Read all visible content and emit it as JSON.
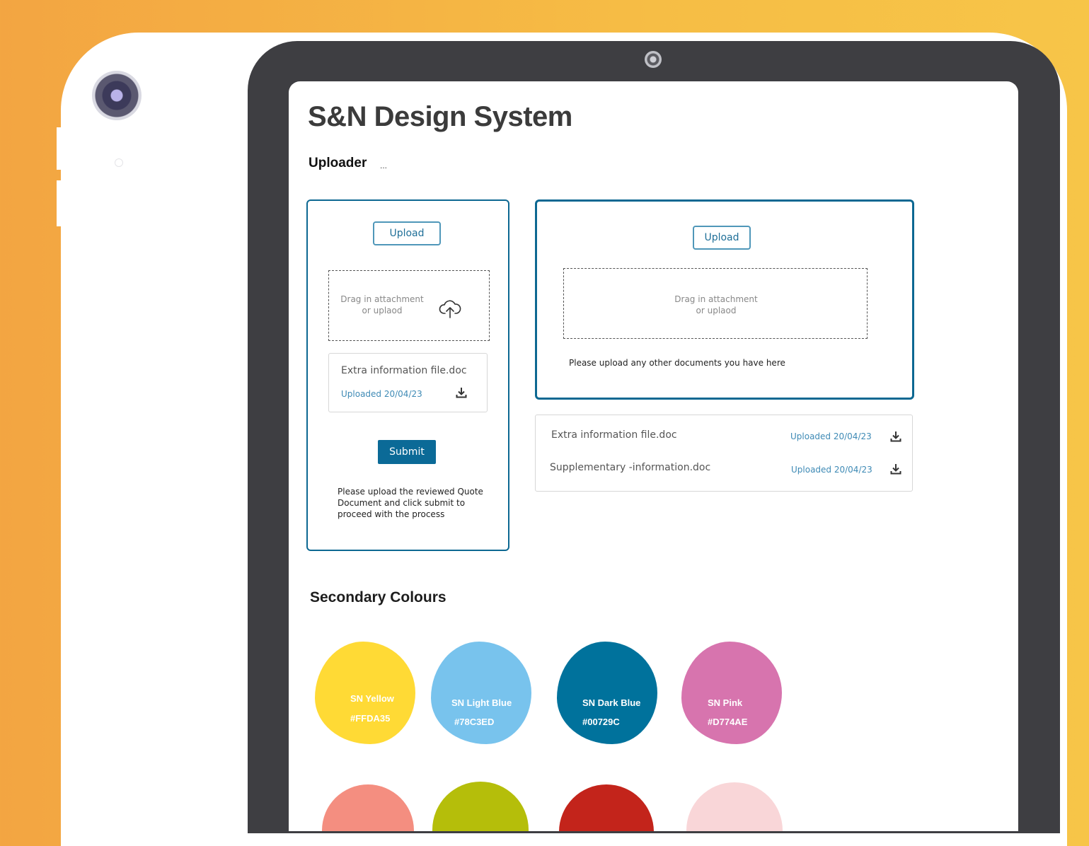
{
  "page": {
    "title": "S&N Design System",
    "section_uploader": "Uploader",
    "section_uploader_extra": "...",
    "section_colours": "Secondary Colours"
  },
  "uploader_left": {
    "upload_label": "Upload",
    "dropzone_line1": "Drag in attachment",
    "dropzone_line2": "or uplaod",
    "file_name": "Extra information file.doc",
    "file_date": "Uploaded 20/04/23",
    "submit_label": "Submit",
    "instructions": [
      "Please upload the reviewed Quote",
      "Document and click submit to",
      "proceed with the process"
    ]
  },
  "uploader_right": {
    "upload_label": "Upload",
    "dropzone_line1": "Drag in attachment",
    "dropzone_line2": "or uplaod",
    "instructions": "Please upload any other documents you have here"
  },
  "file_list": [
    {
      "name": "Extra information file.doc",
      "date": "Uploaded 20/04/23"
    },
    {
      "name": "Supplementary -information.doc",
      "date": "Uploaded 20/04/23"
    }
  ],
  "colours": [
    {
      "name": "SN Yellow",
      "hex": "#FFDA35",
      "color": "#FFDA35"
    },
    {
      "name": "SN Light Blue",
      "hex": "#78C3ED",
      "color": "#78C3ED"
    },
    {
      "name": "SN Dark Blue",
      "hex": "#00729C",
      "color": "#00729C"
    },
    {
      "name": "SN Pink",
      "hex": "#D774AE",
      "color": "#D774AE"
    }
  ],
  "colours_row2": [
    {
      "color": "#F48E80"
    },
    {
      "color": "#B5BE0A"
    },
    {
      "color": "#C3241B"
    },
    {
      "color": "#F9D6D8"
    }
  ]
}
